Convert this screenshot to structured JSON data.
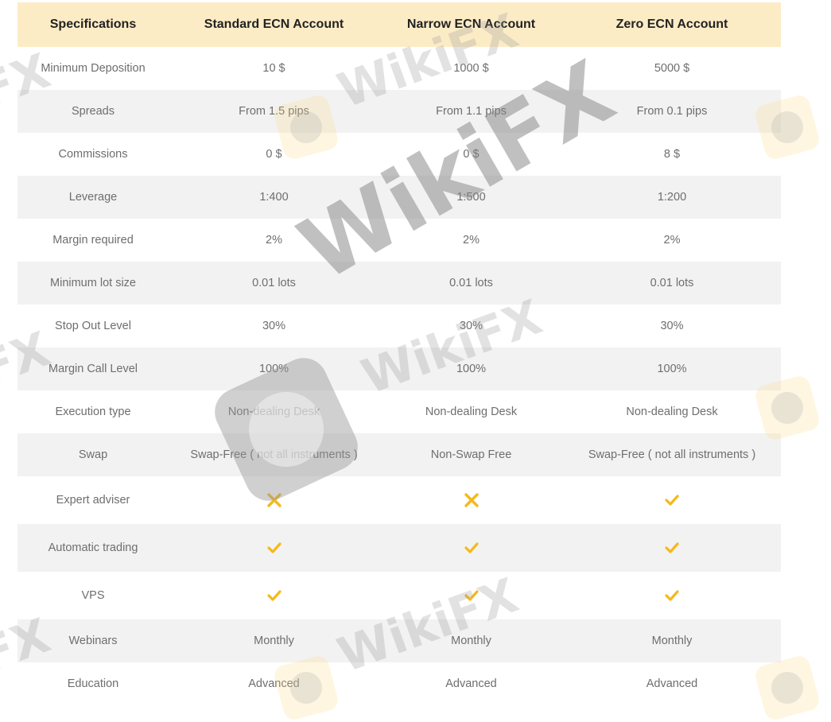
{
  "table": {
    "headers": [
      "Specifications",
      "Standard ECN Account",
      "Narrow ECN Account",
      "Zero ECN Account"
    ],
    "rows": [
      {
        "label": "Minimum Deposition",
        "values": [
          "10 $",
          "1000 $",
          "5000 $"
        ]
      },
      {
        "label": "Spreads",
        "values": [
          "From 1.5 pips",
          "From 1.1 pips",
          "From 0.1 pips"
        ]
      },
      {
        "label": "Commissions",
        "values": [
          "0 $",
          "0 $",
          "8 $"
        ]
      },
      {
        "label": "Leverage",
        "values": [
          "1:400",
          "1:500",
          "1:200"
        ]
      },
      {
        "label": "Margin required",
        "values": [
          "2%",
          "2%",
          "2%"
        ]
      },
      {
        "label": "Minimum lot size",
        "values": [
          "0.01 lots",
          "0.01 lots",
          "0.01 lots"
        ]
      },
      {
        "label": "Stop Out Level",
        "values": [
          "30%",
          "30%",
          "30%"
        ]
      },
      {
        "label": "Margin Call Level",
        "values": [
          "100%",
          "100%",
          "100%"
        ]
      },
      {
        "label": "Execution type",
        "values": [
          "Non-dealing Desk",
          "Non-dealing Desk",
          "Non-dealing Desk"
        ]
      },
      {
        "label": "Swap",
        "values": [
          "Swap-Free ( not all instruments )",
          "Non-Swap Free",
          "Swap-Free ( not all instruments )"
        ]
      },
      {
        "label": "Expert adviser",
        "icons": [
          "cross-icon",
          "cross-icon",
          "check-icon"
        ]
      },
      {
        "label": "Automatic trading",
        "icons": [
          "check-icon",
          "check-icon",
          "check-icon"
        ]
      },
      {
        "label": "VPS",
        "icons": [
          "check-icon",
          "check-icon",
          "check-icon"
        ]
      },
      {
        "label": "Webinars",
        "values": [
          "Monthly",
          "Monthly",
          "Monthly"
        ]
      },
      {
        "label": "Education",
        "values": [
          "Advanced",
          "Advanced",
          "Advanced"
        ]
      }
    ]
  },
  "colors": {
    "header_bg": "#fcecc6",
    "stripe_bg": "#f2f2f2",
    "icon_color": "#f5b91c"
  },
  "watermark": {
    "text": "WikiFX"
  }
}
